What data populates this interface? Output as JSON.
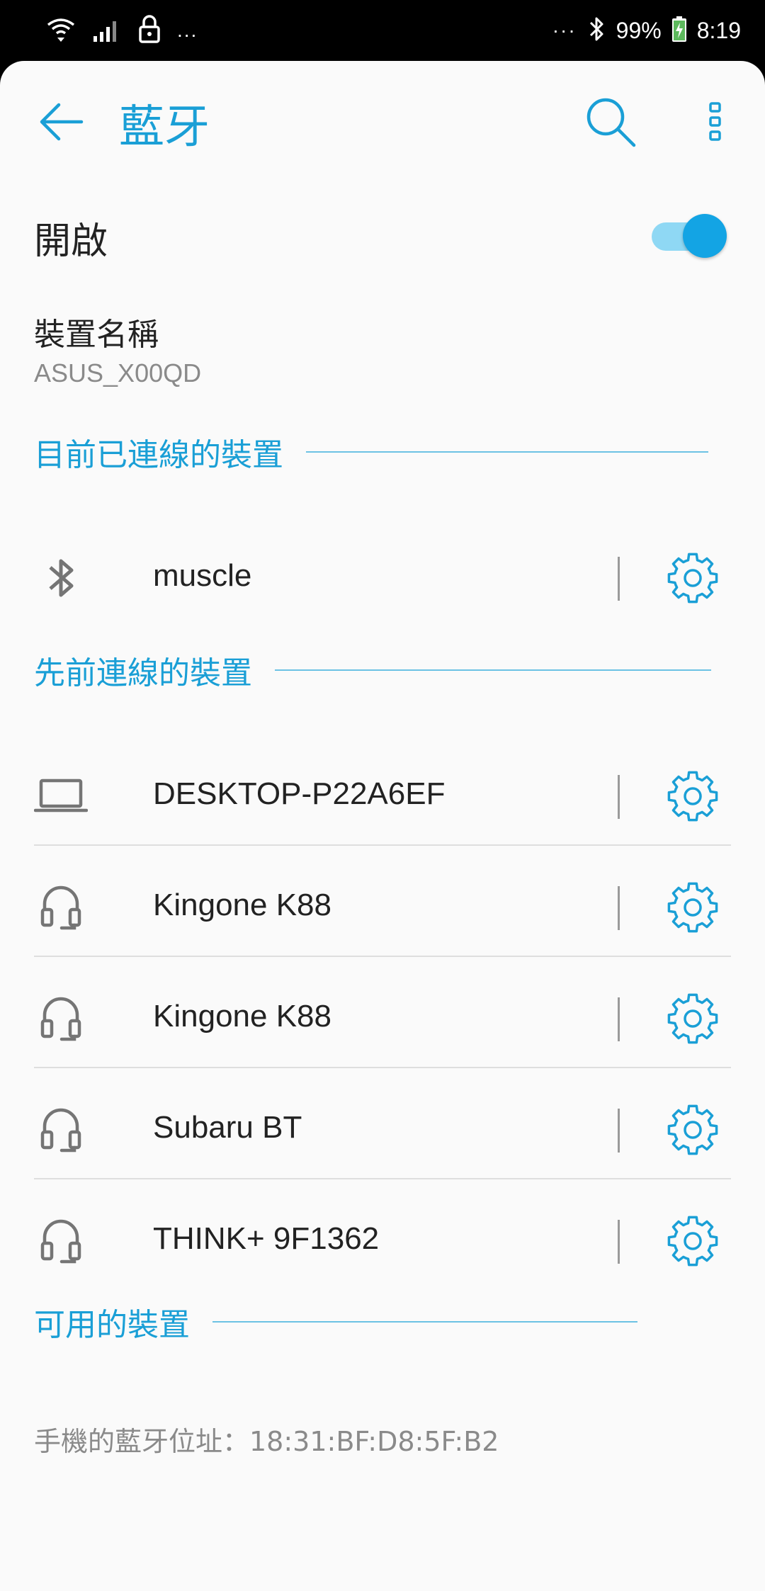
{
  "status_bar": {
    "left_dots": "...",
    "right_dots": "···",
    "battery": "99%",
    "time": "8:19"
  },
  "toolbar": {
    "title": "藍牙"
  },
  "bluetooth_toggle": {
    "label": "開啟",
    "state": "on"
  },
  "device_name": {
    "label": "裝置名稱",
    "value": "ASUS_X00QD"
  },
  "sections": {
    "connected": "目前已連線的裝置",
    "previous": "先前連線的裝置",
    "available": "可用的裝置"
  },
  "connected_devices": [
    {
      "name": "muscle",
      "icon": "bluetooth-icon"
    }
  ],
  "previous_devices": [
    {
      "name": "DESKTOP-P22A6EF",
      "icon": "laptop-icon"
    },
    {
      "name": "Kingone K88",
      "icon": "headset-icon"
    },
    {
      "name": "Kingone K88",
      "icon": "headset-icon"
    },
    {
      "name": "Subaru BT",
      "icon": "headset-icon"
    },
    {
      "name": "THINK+ 9F1362",
      "icon": "headset-icon"
    }
  ],
  "footer": {
    "address": "手機的藍牙位址：18:31:BF:D8:5F:B2"
  },
  "colors": {
    "accent": "#1a9fd6",
    "toggle_track": "#8fd8f4",
    "toggle_knob": "#13a4e4",
    "device_icon": "#757575"
  }
}
